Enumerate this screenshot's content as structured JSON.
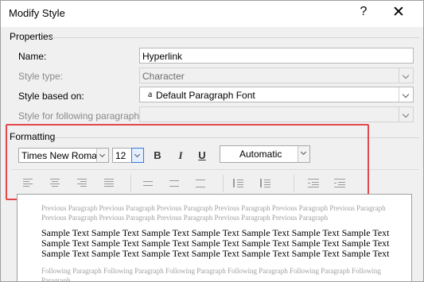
{
  "window": {
    "title": "Modify Style",
    "help_glyph": "?",
    "close_glyph": "✕"
  },
  "properties": {
    "heading": "Properties",
    "name_label": "Name:",
    "name_value": "Hyperlink",
    "style_type_label": "Style type:",
    "style_type_value": "Character",
    "based_on_label": "Style based on:",
    "based_on_icon": "a",
    "based_on_value": "Default Paragraph Font",
    "following_label": "Style for following paragraph:",
    "following_value": ""
  },
  "formatting": {
    "heading": "Formatting",
    "font": "Times New Roman",
    "size": "12",
    "bold": "B",
    "italic": "I",
    "underline": "U",
    "color": "Automatic"
  },
  "preview": {
    "previous": "Previous Paragraph Previous Paragraph Previous Paragraph Previous Paragraph Previous Paragraph Previous Paragraph Previous Paragraph Previous Paragraph Previous Paragraph Previous Paragraph Previous Paragraph",
    "sample": "Sample Text Sample Text Sample Text Sample Text Sample Text Sample Text Sample Text Sample Text Sample Text Sample Text Sample Text Sample Text Sample Text Sample Text Sample Text Sample Text Sample Text Sample Text Sample Text Sample Text Sample Text",
    "following": "Following Paragraph Following Paragraph Following Paragraph Following Paragraph Following Paragraph Following Paragraph"
  },
  "colors": {
    "highlight_box": "#e2474c",
    "accent": "#3a7bd5"
  }
}
